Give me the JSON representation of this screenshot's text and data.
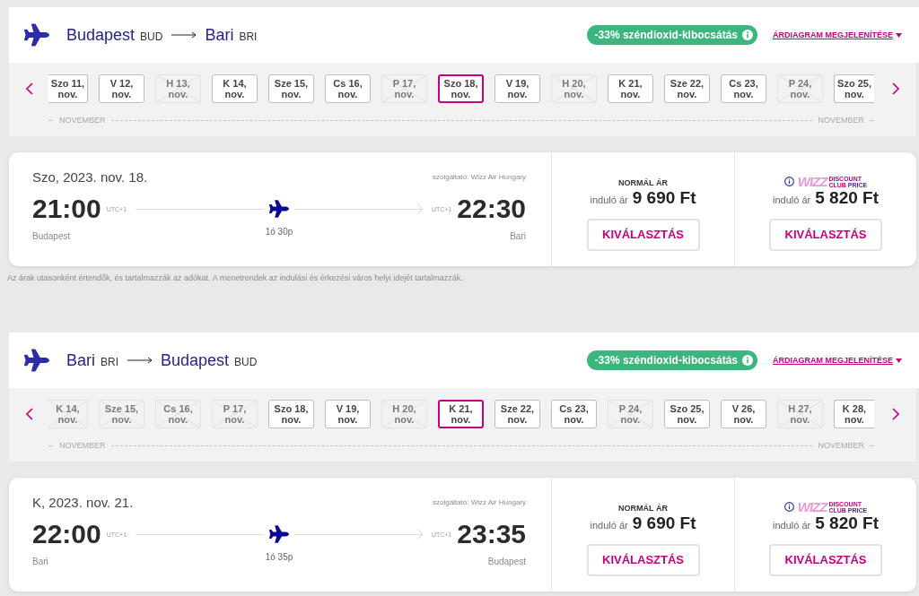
{
  "flights": [
    {
      "header": {
        "origin": {
          "city": "Budapest",
          "code": "BUD"
        },
        "destination": {
          "city": "Bari",
          "code": "BRI"
        },
        "co2_badge": "-33% széndioxid-kibocsátás",
        "price_chart_link": "ÁRDIAGRAM MEGJELENÍTÉSE"
      },
      "date_strip": {
        "dates": [
          {
            "day": "Szo 11,",
            "month": "nov.",
            "disabled": false,
            "selected": false
          },
          {
            "day": "V 12,",
            "month": "nov.",
            "disabled": false,
            "selected": false
          },
          {
            "day": "H 13,",
            "month": "nov.",
            "disabled": true,
            "selected": false
          },
          {
            "day": "K 14,",
            "month": "nov.",
            "disabled": false,
            "selected": false
          },
          {
            "day": "Sze 15,",
            "month": "nov.",
            "disabled": false,
            "selected": false
          },
          {
            "day": "Cs 16,",
            "month": "nov.",
            "disabled": false,
            "selected": false
          },
          {
            "day": "P 17,",
            "month": "nov.",
            "disabled": true,
            "selected": false
          },
          {
            "day": "Szo 18,",
            "month": "nov.",
            "disabled": false,
            "selected": true
          },
          {
            "day": "V 19,",
            "month": "nov.",
            "disabled": false,
            "selected": false
          },
          {
            "day": "H 20,",
            "month": "nov.",
            "disabled": true,
            "selected": false
          },
          {
            "day": "K 21,",
            "month": "nov.",
            "disabled": false,
            "selected": false
          },
          {
            "day": "Sze 22,",
            "month": "nov.",
            "disabled": false,
            "selected": false
          },
          {
            "day": "Cs 23,",
            "month": "nov.",
            "disabled": false,
            "selected": false
          },
          {
            "day": "P 24,",
            "month": "nov.",
            "disabled": true,
            "selected": false
          },
          {
            "day": "Szo 25,",
            "month": "nov.",
            "disabled": false,
            "selected": false
          }
        ],
        "month_labels": [
          "NOVEMBER",
          "NOVEMBER"
        ]
      },
      "flight_card": {
        "date": "Szo, 2023. nov. 18.",
        "operator": "szolgáltató: Wizz Air Hungary",
        "departure": {
          "time": "21:00",
          "timezone": "UTC+1",
          "city": "Budapest"
        },
        "duration": "1ó 30p",
        "arrival": {
          "time": "22:30",
          "timezone": "UTC+1",
          "city": "Bari"
        },
        "fares": [
          {
            "kind": "normal",
            "label": "NORMÁL ÁR",
            "from_label": "induló ár",
            "price": "9 690 Ft",
            "button": "KIVÁLASZTÁS"
          },
          {
            "kind": "discount_club",
            "logo": {
              "wordmark": "WIZZ",
              "tagline": [
                "DISCOUNT",
                "CLUB",
                "PRICE"
              ]
            },
            "from_label": "induló ár",
            "price": "5 820 Ft",
            "button": "KIVÁLASZTÁS"
          }
        ]
      },
      "footnote": "Az árak utasonként értendők, és tartalmazzák az adókat. A menetrendek az indulási és érkezési város helyi idejét tartalmazzák."
    },
    {
      "header": {
        "origin": {
          "city": "Bari",
          "code": "BRI"
        },
        "destination": {
          "city": "Budapest",
          "code": "BUD"
        },
        "co2_badge": "-33% széndioxid-kibocsátás",
        "price_chart_link": "ÁRDIAGRAM MEGJELENÍTÉSE"
      },
      "date_strip": {
        "dates": [
          {
            "day": "K 14,",
            "month": "nov.",
            "disabled": true,
            "selected": false
          },
          {
            "day": "Sze 15,",
            "month": "nov.",
            "disabled": true,
            "selected": false
          },
          {
            "day": "Cs 16,",
            "month": "nov.",
            "disabled": true,
            "selected": false
          },
          {
            "day": "P 17,",
            "month": "nov.",
            "disabled": true,
            "selected": false
          },
          {
            "day": "Szo 18,",
            "month": "nov.",
            "disabled": false,
            "selected": false
          },
          {
            "day": "V 19,",
            "month": "nov.",
            "disabled": false,
            "selected": false
          },
          {
            "day": "H 20,",
            "month": "nov.",
            "disabled": true,
            "selected": false
          },
          {
            "day": "K 21,",
            "month": "nov.",
            "disabled": false,
            "selected": true
          },
          {
            "day": "Sze 22,",
            "month": "nov.",
            "disabled": false,
            "selected": false
          },
          {
            "day": "Cs 23,",
            "month": "nov.",
            "disabled": false,
            "selected": false
          },
          {
            "day": "P 24,",
            "month": "nov.",
            "disabled": true,
            "selected": false
          },
          {
            "day": "Szo 25,",
            "month": "nov.",
            "disabled": false,
            "selected": false
          },
          {
            "day": "V 26,",
            "month": "nov.",
            "disabled": false,
            "selected": false
          },
          {
            "day": "H 27,",
            "month": "nov.",
            "disabled": true,
            "selected": false
          },
          {
            "day": "K 28,",
            "month": "nov.",
            "disabled": false,
            "selected": false
          }
        ],
        "month_labels": [
          "NOVEMBER",
          "NOVEMBER"
        ]
      },
      "flight_card": {
        "date": "K, 2023. nov. 21.",
        "operator": "szolgáltató: Wizz Air Hungary",
        "departure": {
          "time": "22:00",
          "timezone": "UTC+1",
          "city": "Bari"
        },
        "duration": "1ó 35p",
        "arrival": {
          "time": "23:35",
          "timezone": "UTC+1",
          "city": "Budapest"
        },
        "fares": [
          {
            "kind": "normal",
            "label": "NORMÁL ÁR",
            "from_label": "induló ár",
            "price": "9 690 Ft",
            "button": "KIVÁLASZTÁS"
          },
          {
            "kind": "discount_club",
            "logo": {
              "wordmark": "WIZZ",
              "tagline": [
                "DISCOUNT",
                "CLUB",
                "PRICE"
              ]
            },
            "from_label": "induló ár",
            "price": "5 820 Ft",
            "button": "KIVÁLASZTÁS"
          }
        ]
      }
    }
  ]
}
